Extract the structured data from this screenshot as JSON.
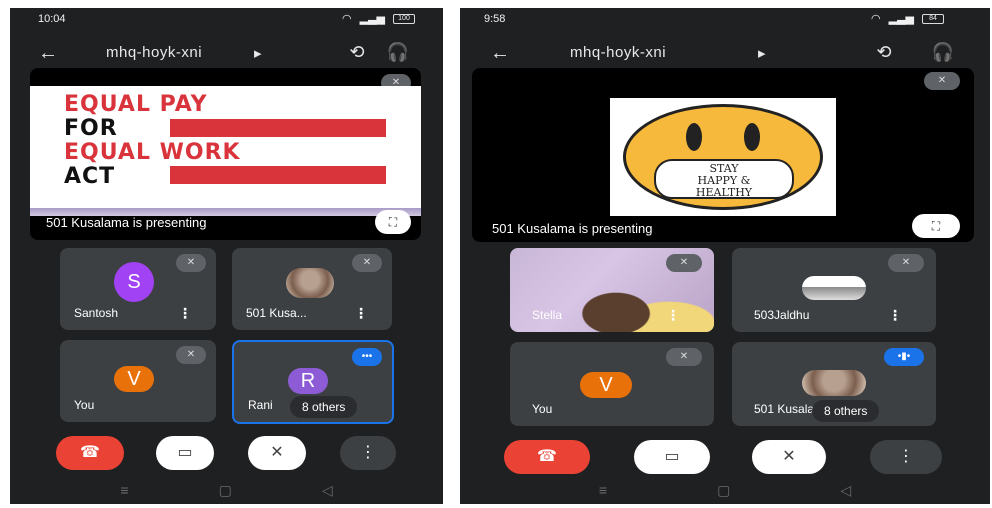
{
  "screens": [
    {
      "status": {
        "time": "10:04",
        "battery": "100"
      },
      "meeting_code": "mhq-hoyk-xni",
      "slide": {
        "lines": [
          "EQUAL PAY",
          "FOR",
          "EQUAL WORK",
          "ACT"
        ]
      },
      "presenting_text": "501 Kusalama is presenting",
      "tiles": [
        {
          "name": "Santosh",
          "initial": "S",
          "avatar_color": "#a142f4"
        },
        {
          "name": "501 Kusa...",
          "initial": ""
        },
        {
          "name": "You",
          "initial": "V",
          "avatar_color": "#e8710a"
        },
        {
          "name": "Rani",
          "initial": "R",
          "avatar_color": "#8e5bd6",
          "others": "8 others"
        }
      ]
    },
    {
      "status": {
        "time": "9:58",
        "battery": "84"
      },
      "meeting_code": "mhq-hoyk-xni",
      "slide": {
        "lines": [
          "STAY",
          "HAPPY",
          "&",
          "HEALTHY"
        ]
      },
      "presenting_text": "501 Kusalama is presenting",
      "tiles": [
        {
          "name": "Stella",
          "initial": ""
        },
        {
          "name": "503Jaldhu",
          "initial": ""
        },
        {
          "name": "You",
          "initial": "V",
          "avatar_color": "#e8710a"
        },
        {
          "name": "501 Kusalama",
          "initial": "",
          "others": "8 others"
        }
      ]
    }
  ],
  "icons": {
    "back": "←",
    "switch_camera": "⟲",
    "audio_output": "🎧",
    "mic_off": "🎙",
    "fullscreen": "⛶",
    "more": "⋮",
    "end_call": "☎",
    "camera_off": "▭",
    "nav_menu": "≡",
    "nav_home": "▢",
    "nav_back": "◁"
  }
}
